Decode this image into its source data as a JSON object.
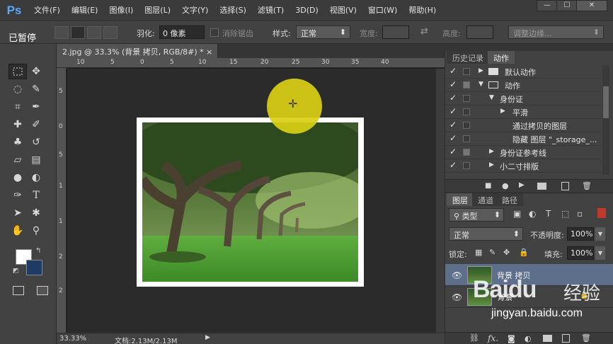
{
  "menubar": {
    "logo": "Ps",
    "items": [
      "文件(F)",
      "编辑(E)",
      "图像(I)",
      "图层(L)",
      "文字(Y)",
      "选择(S)",
      "滤镜(T)",
      "3D(D)",
      "视图(V)",
      "窗口(W)",
      "帮助(H)"
    ],
    "window_buttons": [
      "—",
      "☐",
      "✕"
    ]
  },
  "overlay": {
    "paused_label": "已暂停"
  },
  "options": {
    "feather_label": "羽化:",
    "feather_value": "0 像素",
    "antialias_label": "消除锯齿",
    "style_label": "样式:",
    "style_value": "正常",
    "width_label": "宽度:",
    "height_label": "高度:",
    "refine_edge_label": "调整边缘..."
  },
  "document": {
    "tab_title": "2.jpg @ 33.3% (背景 拷贝, RGB/8#) *",
    "close_icon": "×",
    "ruler_top_labels": [
      "10",
      "5",
      "0",
      "5",
      "10",
      "15",
      "20",
      "25",
      "30",
      "35",
      "40"
    ],
    "ruler_left_labels": [
      "5",
      "0",
      "5",
      "1",
      "1",
      "2",
      "2"
    ],
    "zoom": "33.33%",
    "doc_info": "文档:2.13M/2.13M"
  },
  "actions_panel": {
    "tabs": [
      "历史记录",
      "动作"
    ],
    "rows": [
      {
        "label": "默认动作",
        "level": 0,
        "type": "folder",
        "dialog": false
      },
      {
        "label": "动作",
        "level": 0,
        "type": "folder-open",
        "dialog": true
      },
      {
        "label": "身份证",
        "level": 1,
        "type": "action-open",
        "dialog": false
      },
      {
        "label": "平滑",
        "level": 2,
        "type": "step",
        "dialog": false
      },
      {
        "label": "通过拷贝的图层",
        "level": 3,
        "type": "step",
        "dialog": false
      },
      {
        "label": "隐藏 图层 \"_storage_...",
        "level": 3,
        "type": "step",
        "dialog": false
      },
      {
        "label": "身份证参考线",
        "level": 1,
        "type": "action",
        "dialog": true
      },
      {
        "label": "小二寸排版",
        "level": 1,
        "type": "action",
        "dialog": false
      }
    ]
  },
  "layers_panel": {
    "tabs": [
      "图层",
      "通道",
      "路径"
    ],
    "filter_kind": "类型",
    "blend_mode": "正常",
    "opacity_label": "不透明度:",
    "opacity_value": "100%",
    "lock_label": "锁定:",
    "fill_label": "填充:",
    "fill_value": "100%",
    "layers": [
      {
        "name": "背景 拷贝",
        "selected": true,
        "locked": false
      },
      {
        "name": "背景",
        "selected": false,
        "locked": true
      }
    ],
    "footer_fx": "fx."
  },
  "watermark": {
    "brand": "Baidu",
    "brand_cn": "经验",
    "url": "jingyan.baidu.com"
  },
  "colors": {
    "accent_cursor": "#d9cf13",
    "foreground": "#ffffff",
    "background": "#1f3a63",
    "selection": "#5d6f8a"
  }
}
